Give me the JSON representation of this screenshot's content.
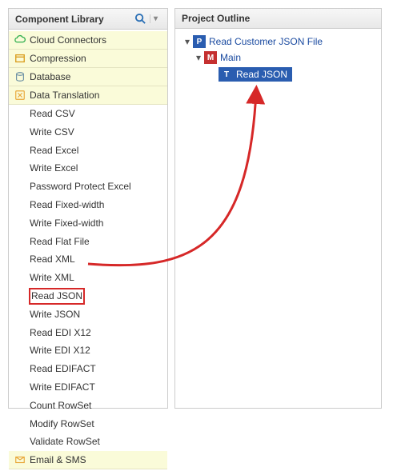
{
  "left": {
    "title": "Component Library",
    "categories": [
      {
        "id": "cloud",
        "label": "Cloud Connectors",
        "icon": "cloud",
        "color": "#2fae4e",
        "expanded": false
      },
      {
        "id": "compression",
        "label": "Compression",
        "icon": "archive",
        "color": "#d99b1a",
        "expanded": false
      },
      {
        "id": "database",
        "label": "Database",
        "icon": "db",
        "color": "#6a8fa3",
        "expanded": false
      },
      {
        "id": "data-translation",
        "label": "Data Translation",
        "icon": "translate",
        "color": "#e8a535",
        "expanded": true,
        "items": [
          "Read CSV",
          "Write CSV",
          "Read Excel",
          "Write Excel",
          "Password Protect Excel",
          "Read Fixed-width",
          "Write Fixed-width",
          "Read Flat File",
          "Read XML",
          "Write XML",
          "Read JSON",
          "Write JSON",
          "Read EDI X12",
          "Write EDI X12",
          "Read EDIFACT",
          "Write EDIFACT",
          "Count RowSet",
          "Modify RowSet",
          "Validate RowSet"
        ],
        "highlighted_item": "Read JSON"
      },
      {
        "id": "email-sms",
        "label": "Email & SMS",
        "icon": "mail",
        "color": "#e8a535",
        "expanded": false
      }
    ]
  },
  "right": {
    "title": "Project Outline",
    "tree": {
      "root": {
        "badge": "P",
        "label": "Read Customer JSON File",
        "expanded": true
      },
      "child1": {
        "badge": "M",
        "label": "Main",
        "expanded": true
      },
      "child2": {
        "badge": "T",
        "label": "Read JSON",
        "selected": true
      }
    }
  }
}
